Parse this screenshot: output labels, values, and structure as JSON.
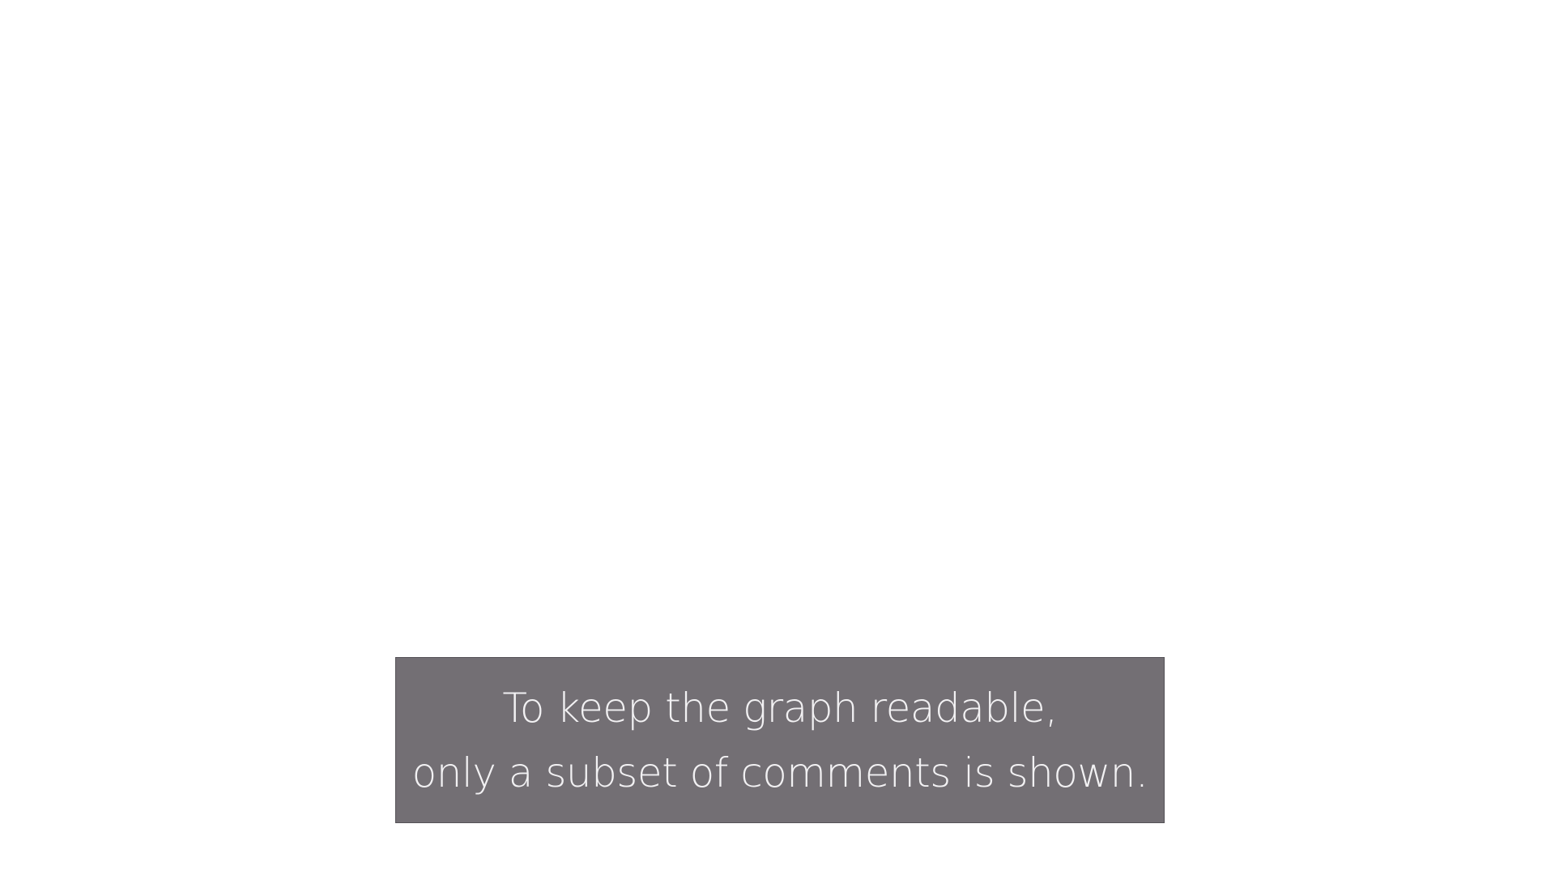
{
  "notice": {
    "lines": [
      "To keep the graph readable,",
      "only a subset of comments is shown."
    ]
  },
  "colors": {
    "background": "#ffffff",
    "notice_background": "#736f74",
    "notice_border": "#555257",
    "notice_text": "#f2f1f3"
  }
}
